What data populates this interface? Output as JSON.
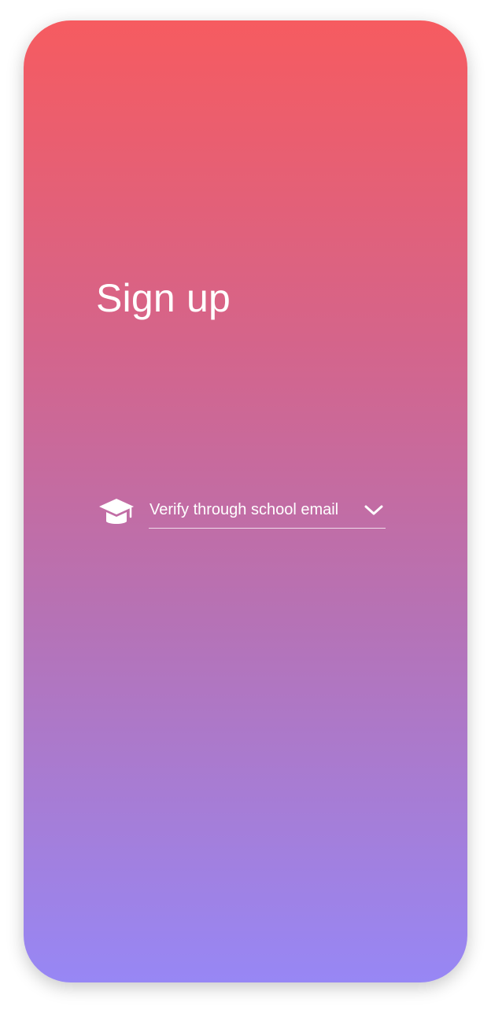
{
  "screen": {
    "title": "Sign up",
    "gradient_top": "#f65b60",
    "gradient_bottom": "#9787f5"
  },
  "verification": {
    "icon": "graduation-cap-icon",
    "selected_option": "Verify through school email",
    "dropdown_icon": "chevron-down-icon"
  }
}
